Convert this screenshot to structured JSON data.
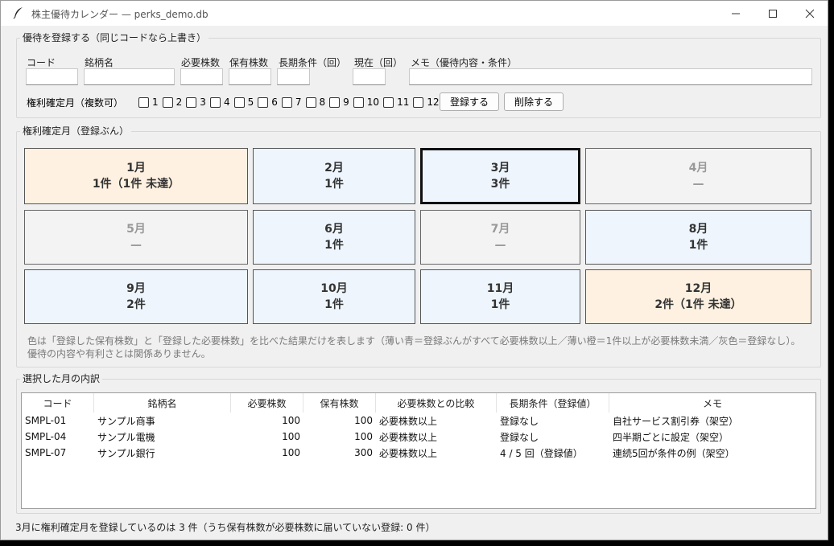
{
  "window": {
    "title": "株主優待カレンダー — perks_demo.db"
  },
  "register": {
    "group_label": "優待を登録する（同じコードなら上書き）",
    "code_label": "コード",
    "name_label": "銘柄名",
    "required_label": "必要株数",
    "held_label": "保有株数",
    "long_term_label": "長期条件（回）",
    "current_label": "現在（回）",
    "memo_label": "メモ（優待内容・条件）",
    "months_label": "権利確定月（複数可）",
    "months": [
      "1",
      "2",
      "3",
      "4",
      "5",
      "6",
      "7",
      "8",
      "9",
      "10",
      "11",
      "12"
    ],
    "register_button": "登録する",
    "delete_button": "削除する"
  },
  "calendar": {
    "group_label": "権利確定月（登録ぶん）",
    "selected_month": "3月",
    "tiles": [
      {
        "month": "1月",
        "summary": "1件（1件 未達）",
        "status": "orange"
      },
      {
        "month": "2月",
        "summary": "1件",
        "status": "blue"
      },
      {
        "month": "3月",
        "summary": "3件",
        "status": "blue"
      },
      {
        "month": "4月",
        "summary": "—",
        "status": "gray"
      },
      {
        "month": "5月",
        "summary": "—",
        "status": "gray"
      },
      {
        "month": "6月",
        "summary": "1件",
        "status": "blue"
      },
      {
        "month": "7月",
        "summary": "—",
        "status": "gray"
      },
      {
        "month": "8月",
        "summary": "1件",
        "status": "blue"
      },
      {
        "month": "9月",
        "summary": "2件",
        "status": "blue"
      },
      {
        "month": "10月",
        "summary": "1件",
        "status": "blue"
      },
      {
        "month": "11月",
        "summary": "1件",
        "status": "blue"
      },
      {
        "month": "12月",
        "summary": "2件（1件 未達）",
        "status": "orange"
      }
    ],
    "note_line1": "色は「登録した保有株数」と「登録した必要株数」を比べた結果だけを表します（薄い青＝登録ぶんがすべて必要株数以上／薄い橙＝1件以上が必要株数未満／灰色＝登録なし）。",
    "note_line2": "優待の内容や有利さとは関係ありません。"
  },
  "detail": {
    "group_label": "選択した月の内訳",
    "columns": [
      "コード",
      "銘柄名",
      "必要株数",
      "保有株数",
      "必要株数との比較",
      "長期条件（登録値）",
      "メモ"
    ],
    "rows": [
      [
        "SMPL-01",
        "サンプル商事",
        "100",
        "100",
        "必要株数以上",
        "登録なし",
        "自社サービス割引券（架空）"
      ],
      [
        "SMPL-04",
        "サンプル電機",
        "100",
        "100",
        "必要株数以上",
        "登録なし",
        "四半期ごとに設定（架空）"
      ],
      [
        "SMPL-07",
        "サンプル銀行",
        "100",
        "300",
        "必要株数以上",
        "4 / 5 回（登録値）",
        "連続5回が条件の例（架空）"
      ]
    ]
  },
  "status": "3月に権利確定月を登録しているのは 3 件（うち保有株数が必要株数に届いていない登録: 0 件）"
}
